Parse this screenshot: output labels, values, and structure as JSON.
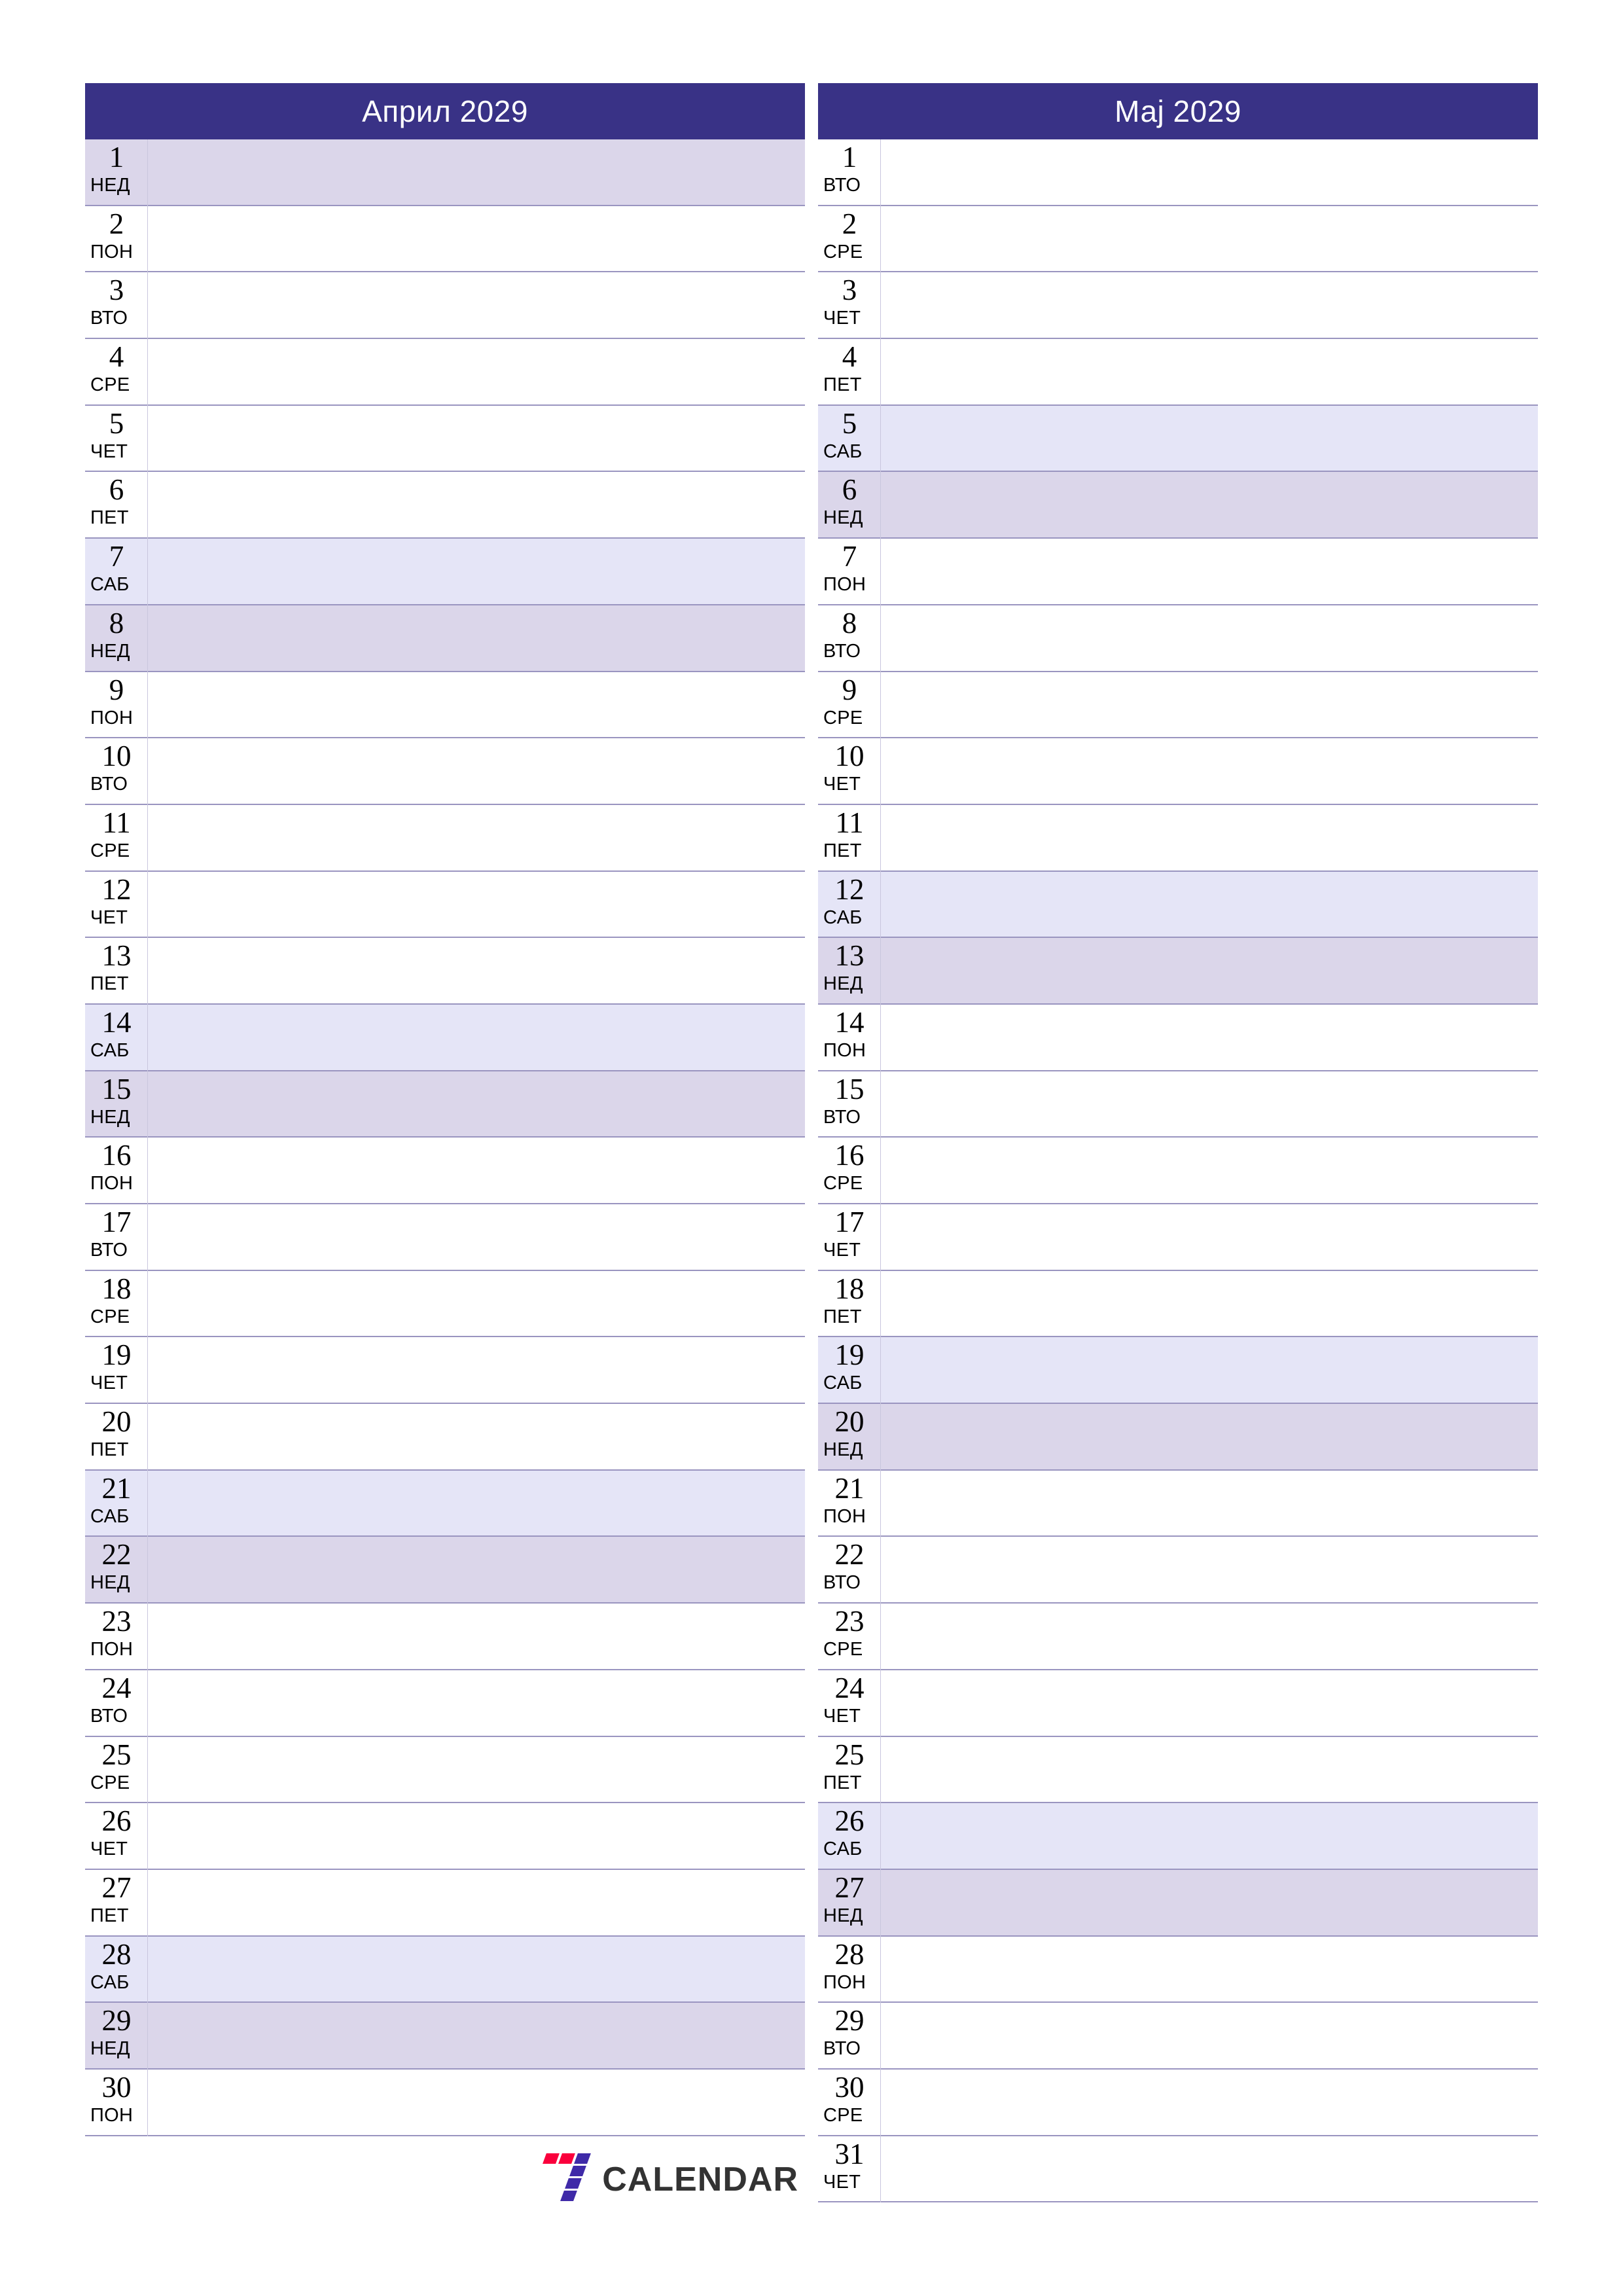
{
  "document": {
    "type": "monthly-planner",
    "orientation": "portrait",
    "locale": "sr",
    "year": 2029
  },
  "theme": {
    "header_bg": "#393286",
    "header_text": "#ffffff",
    "row_border": "#9a95c0",
    "saturday_bg": "#e5e5f7",
    "sunday_bg": "#dbd6ea",
    "weekday_bg": "#ffffff",
    "text": "#000000",
    "logo_red": "#fa003c",
    "logo_purple": "#3f2aa8",
    "logo_wordmark": "#333333"
  },
  "logo": {
    "mark": "seven-stripes-icon",
    "text": "CALENDAR"
  },
  "months": [
    {
      "title": "Април 2029",
      "days": [
        {
          "num": "1",
          "wd": "НЕД",
          "kind": "sun"
        },
        {
          "num": "2",
          "wd": "ПОН",
          "kind": "weekday"
        },
        {
          "num": "3",
          "wd": "ВТО",
          "kind": "weekday"
        },
        {
          "num": "4",
          "wd": "СРЕ",
          "kind": "weekday"
        },
        {
          "num": "5",
          "wd": "ЧЕТ",
          "kind": "weekday"
        },
        {
          "num": "6",
          "wd": "ПЕТ",
          "kind": "weekday"
        },
        {
          "num": "7",
          "wd": "САБ",
          "kind": "sat"
        },
        {
          "num": "8",
          "wd": "НЕД",
          "kind": "sun"
        },
        {
          "num": "9",
          "wd": "ПОН",
          "kind": "weekday"
        },
        {
          "num": "10",
          "wd": "ВТО",
          "kind": "weekday"
        },
        {
          "num": "11",
          "wd": "СРЕ",
          "kind": "weekday"
        },
        {
          "num": "12",
          "wd": "ЧЕТ",
          "kind": "weekday"
        },
        {
          "num": "13",
          "wd": "ПЕТ",
          "kind": "weekday"
        },
        {
          "num": "14",
          "wd": "САБ",
          "kind": "sat"
        },
        {
          "num": "15",
          "wd": "НЕД",
          "kind": "sun"
        },
        {
          "num": "16",
          "wd": "ПОН",
          "kind": "weekday"
        },
        {
          "num": "17",
          "wd": "ВТО",
          "kind": "weekday"
        },
        {
          "num": "18",
          "wd": "СРЕ",
          "kind": "weekday"
        },
        {
          "num": "19",
          "wd": "ЧЕТ",
          "kind": "weekday"
        },
        {
          "num": "20",
          "wd": "ПЕТ",
          "kind": "weekday"
        },
        {
          "num": "21",
          "wd": "САБ",
          "kind": "sat"
        },
        {
          "num": "22",
          "wd": "НЕД",
          "kind": "sun"
        },
        {
          "num": "23",
          "wd": "ПОН",
          "kind": "weekday"
        },
        {
          "num": "24",
          "wd": "ВТО",
          "kind": "weekday"
        },
        {
          "num": "25",
          "wd": "СРЕ",
          "kind": "weekday"
        },
        {
          "num": "26",
          "wd": "ЧЕТ",
          "kind": "weekday"
        },
        {
          "num": "27",
          "wd": "ПЕТ",
          "kind": "weekday"
        },
        {
          "num": "28",
          "wd": "САБ",
          "kind": "sat"
        },
        {
          "num": "29",
          "wd": "НЕД",
          "kind": "sun"
        },
        {
          "num": "30",
          "wd": "ПОН",
          "kind": "weekday"
        }
      ]
    },
    {
      "title": "Мај 2029",
      "days": [
        {
          "num": "1",
          "wd": "ВТО",
          "kind": "weekday"
        },
        {
          "num": "2",
          "wd": "СРЕ",
          "kind": "weekday"
        },
        {
          "num": "3",
          "wd": "ЧЕТ",
          "kind": "weekday"
        },
        {
          "num": "4",
          "wd": "ПЕТ",
          "kind": "weekday"
        },
        {
          "num": "5",
          "wd": "САБ",
          "kind": "sat"
        },
        {
          "num": "6",
          "wd": "НЕД",
          "kind": "sun"
        },
        {
          "num": "7",
          "wd": "ПОН",
          "kind": "weekday"
        },
        {
          "num": "8",
          "wd": "ВТО",
          "kind": "weekday"
        },
        {
          "num": "9",
          "wd": "СРЕ",
          "kind": "weekday"
        },
        {
          "num": "10",
          "wd": "ЧЕТ",
          "kind": "weekday"
        },
        {
          "num": "11",
          "wd": "ПЕТ",
          "kind": "weekday"
        },
        {
          "num": "12",
          "wd": "САБ",
          "kind": "sat"
        },
        {
          "num": "13",
          "wd": "НЕД",
          "kind": "sun"
        },
        {
          "num": "14",
          "wd": "ПОН",
          "kind": "weekday"
        },
        {
          "num": "15",
          "wd": "ВТО",
          "kind": "weekday"
        },
        {
          "num": "16",
          "wd": "СРЕ",
          "kind": "weekday"
        },
        {
          "num": "17",
          "wd": "ЧЕТ",
          "kind": "weekday"
        },
        {
          "num": "18",
          "wd": "ПЕТ",
          "kind": "weekday"
        },
        {
          "num": "19",
          "wd": "САБ",
          "kind": "sat"
        },
        {
          "num": "20",
          "wd": "НЕД",
          "kind": "sun"
        },
        {
          "num": "21",
          "wd": "ПОН",
          "kind": "weekday"
        },
        {
          "num": "22",
          "wd": "ВТО",
          "kind": "weekday"
        },
        {
          "num": "23",
          "wd": "СРЕ",
          "kind": "weekday"
        },
        {
          "num": "24",
          "wd": "ЧЕТ",
          "kind": "weekday"
        },
        {
          "num": "25",
          "wd": "ПЕТ",
          "kind": "weekday"
        },
        {
          "num": "26",
          "wd": "САБ",
          "kind": "sat"
        },
        {
          "num": "27",
          "wd": "НЕД",
          "kind": "sun"
        },
        {
          "num": "28",
          "wd": "ПОН",
          "kind": "weekday"
        },
        {
          "num": "29",
          "wd": "ВТО",
          "kind": "weekday"
        },
        {
          "num": "30",
          "wd": "СРЕ",
          "kind": "weekday"
        },
        {
          "num": "31",
          "wd": "ЧЕТ",
          "kind": "weekday"
        }
      ]
    }
  ]
}
